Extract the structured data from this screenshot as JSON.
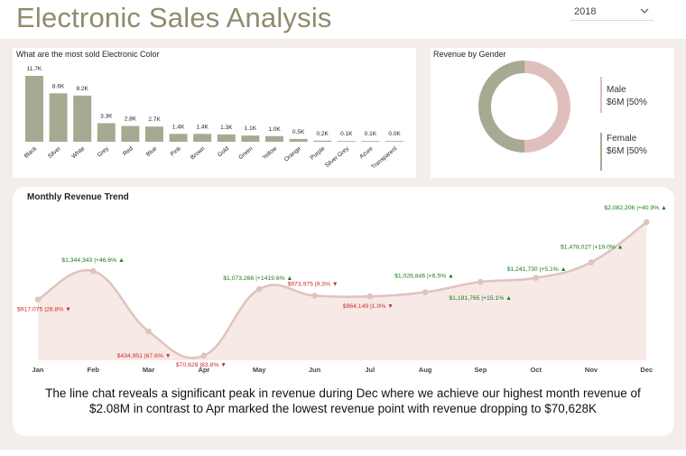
{
  "header": {
    "title": "Electronic Sales Analysis"
  },
  "year_filter": {
    "selected": "2018"
  },
  "color_chart_title": "What are the most sold Electronic Color",
  "gender_chart_title": "Revenue by Gender",
  "trend_chart_title": "Monthly Revenue Trend",
  "insight_text": "The line chat reveals a significant peak in revenue during Dec where we achieve our highest month revenue of $2.08M in contrast to Apr marked the lowest revenue point with revenue dropping to $70,628K",
  "colors": {
    "bar": "#a8a993",
    "male": "#dfbfbb",
    "female": "#a8a993",
    "line": "#e0c3bd",
    "up": "#1a7a1a",
    "down": "#cc2a2a"
  },
  "chart_data": [
    {
      "type": "bar",
      "title": "What are the most sold Electronic Color",
      "categories": [
        "Black",
        "Silver",
        "White",
        "Grey",
        "Red",
        "Blue",
        "Pink",
        "Brown",
        "Gold",
        "Green",
        "Yellow",
        "Orange",
        "Purple",
        "Silver Grey",
        "Azure",
        "Transparent"
      ],
      "values": [
        11.7,
        8.6,
        8.2,
        3.3,
        2.8,
        2.7,
        1.4,
        1.4,
        1.3,
        1.1,
        1.0,
        0.5,
        0.2,
        0.1,
        0.1,
        0.0
      ],
      "data_labels": [
        "11.7K",
        "8.6K",
        "8.2K",
        "3.3K",
        "2.8K",
        "2.7K",
        "1.4K",
        "1.4K",
        "1.3K",
        "1.1K",
        "1.0K",
        "0.5K",
        "0.2K",
        "0.1K",
        "0.1K",
        "0.0K"
      ]
    },
    {
      "type": "pie",
      "title": "Revenue by Gender",
      "slices": [
        {
          "name": "Male",
          "value": 50,
          "label": "$6M |50%"
        },
        {
          "name": "Female",
          "value": 50,
          "label": "$6M |50%"
        }
      ]
    },
    {
      "type": "area",
      "title": "Monthly Revenue Trend",
      "categories": [
        "Jan",
        "Feb",
        "Mar",
        "Apr",
        "May",
        "Jun",
        "Jul",
        "Aug",
        "Sep",
        "Oct",
        "Nov",
        "Dec"
      ],
      "values": [
        917075,
        1344343,
        434951,
        70628,
        1073266,
        973975,
        964149,
        1026846,
        1181765,
        1241730,
        1478027,
        2082206
      ],
      "labels": [
        {
          "value": "$917,075",
          "change": "28.8%",
          "dir": "down"
        },
        {
          "value": "$1,344,343",
          "change": "+46.6%",
          "dir": "up"
        },
        {
          "value": "$434,951",
          "change": "67.6%",
          "dir": "down"
        },
        {
          "value": "$70,628",
          "change": "83.8%",
          "dir": "down"
        },
        {
          "value": "$1,073,266",
          "change": "+1419.6%",
          "dir": "up"
        },
        {
          "value": "$973,975",
          "change": "9.3%",
          "dir": "down"
        },
        {
          "value": "$964,149",
          "change": "1.0%",
          "dir": "down"
        },
        {
          "value": "$1,026,846",
          "change": "+6.5%",
          "dir": "up"
        },
        {
          "value": "$1,181,765",
          "change": "+15.1%",
          "dir": "up"
        },
        {
          "value": "$1,241,730",
          "change": "+5.1%",
          "dir": "up"
        },
        {
          "value": "$1,478,027",
          "change": "+19.0%",
          "dir": "up"
        },
        {
          "value": "$2,082,206",
          "change": "+40.9%",
          "dir": "up"
        }
      ]
    }
  ]
}
